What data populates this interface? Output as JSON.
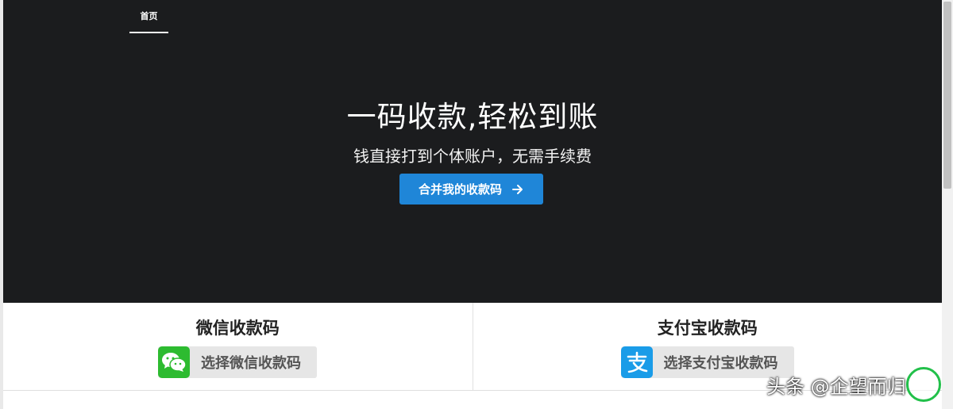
{
  "nav": {
    "home_tab": "首页"
  },
  "hero": {
    "title": "一码收款,轻松到账",
    "subtitle": "钱直接打到个体账户，无需手续费",
    "cta_label": "合并我的收款码"
  },
  "cards": {
    "wechat": {
      "title": "微信收款码",
      "button_label": "选择微信收款码",
      "icon": "wechat-icon"
    },
    "alipay": {
      "title": "支付宝收款码",
      "button_label": "选择支付宝收款码",
      "icon": "alipay-icon"
    }
  },
  "watermark": {
    "text": "头条 @企望而归"
  },
  "colors": {
    "hero_bg": "#1b1c1e",
    "cta_blue": "#1f86d8",
    "wechat_green": "#2dbb30",
    "alipay_blue": "#1a9ce8"
  }
}
